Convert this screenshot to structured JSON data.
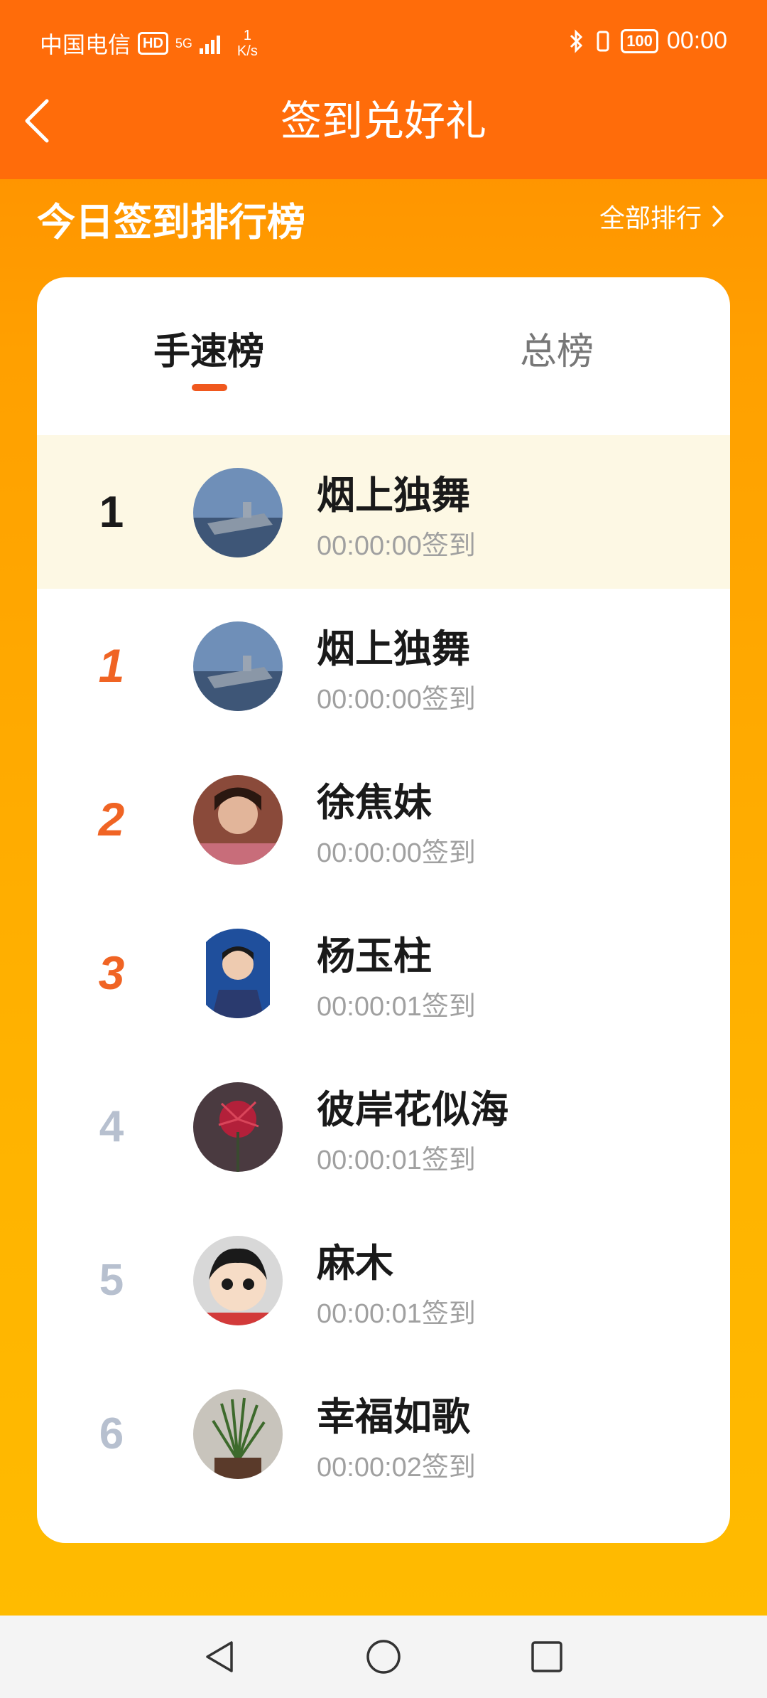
{
  "status_bar": {
    "carrier": "中国电信",
    "hd_badge": "HD",
    "network": "5G",
    "speed_value": "1",
    "speed_unit": "K/s",
    "battery": "100",
    "time": "00:00"
  },
  "header": {
    "title": "签到兑好礼",
    "back_icon": "chevron-left-icon"
  },
  "section": {
    "title": "今日签到排行榜",
    "all_rank_label": "全部排行"
  },
  "tabs": [
    {
      "label": "手速榜",
      "active": true
    },
    {
      "label": "总榜",
      "active": false
    }
  ],
  "my_entry": {
    "rank": "1",
    "name": "烟上独舞",
    "time": "00:00:00签到"
  },
  "ranking": [
    {
      "rank": "1",
      "name": "烟上独舞",
      "time": "00:00:00签到"
    },
    {
      "rank": "2",
      "name": "徐焦妹",
      "time": "00:00:00签到"
    },
    {
      "rank": "3",
      "name": "杨玉柱",
      "time": "00:00:01签到"
    },
    {
      "rank": "4",
      "name": "彼岸花似海",
      "time": "00:00:01签到"
    },
    {
      "rank": "5",
      "name": "麻木",
      "time": "00:00:01签到"
    },
    {
      "rank": "6",
      "name": "幸福如歌",
      "time": "00:00:02签到"
    }
  ],
  "colors": {
    "header_bg": "#ff6c0a",
    "accent": "#f0581e",
    "medal_rank": "#f06424",
    "gray_rank": "#b7c0cf",
    "highlight_row": "#fdf8e4"
  },
  "nav_bar": {
    "back": "triangle-back-icon",
    "home": "circle-home-icon",
    "recents": "square-recents-icon"
  }
}
